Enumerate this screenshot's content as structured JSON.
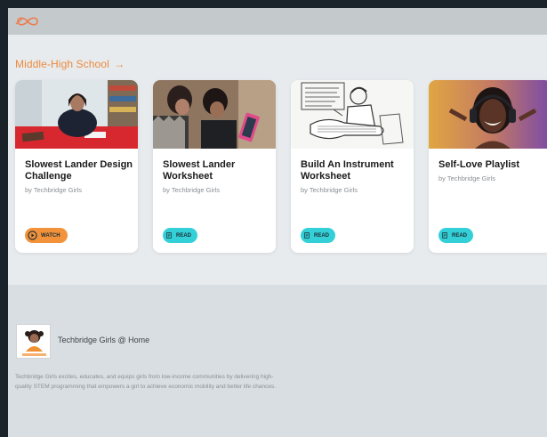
{
  "header": {
    "logo_icon": "infinity-brand-logo",
    "brand_color": "#ee8a3c"
  },
  "section": {
    "title": "Middle-High School",
    "arrow": "→"
  },
  "cards": [
    {
      "title": "Slowest Lander Design Challenge",
      "author": "by Techbridge Girls",
      "action": "WATCH",
      "action_icon": "play-circle-icon",
      "action_color": "#f2933b"
    },
    {
      "title": "Slowest Lander Worksheet",
      "author": "by Techbridge Girls",
      "action": "READ",
      "action_icon": "document-icon",
      "action_color": "#34d0d8"
    },
    {
      "title": "Build An Instrument Worksheet",
      "author": "by Techbridge Girls",
      "action": "READ",
      "action_icon": "document-icon",
      "action_color": "#34d0d8"
    },
    {
      "title": "Self-Love Playlist",
      "author": "by Techbridge Girls",
      "action": "READ",
      "action_icon": "document-icon",
      "action_color": "#34d0d8"
    }
  ],
  "footer": {
    "org_name": "Techbridge Girls @ Home",
    "description": "Techbridge Girls excites, educates, and equips girls from low-income communities by delivering high-quality STEM programming that empowers a girl to achieve economic mobility and better life chances."
  }
}
